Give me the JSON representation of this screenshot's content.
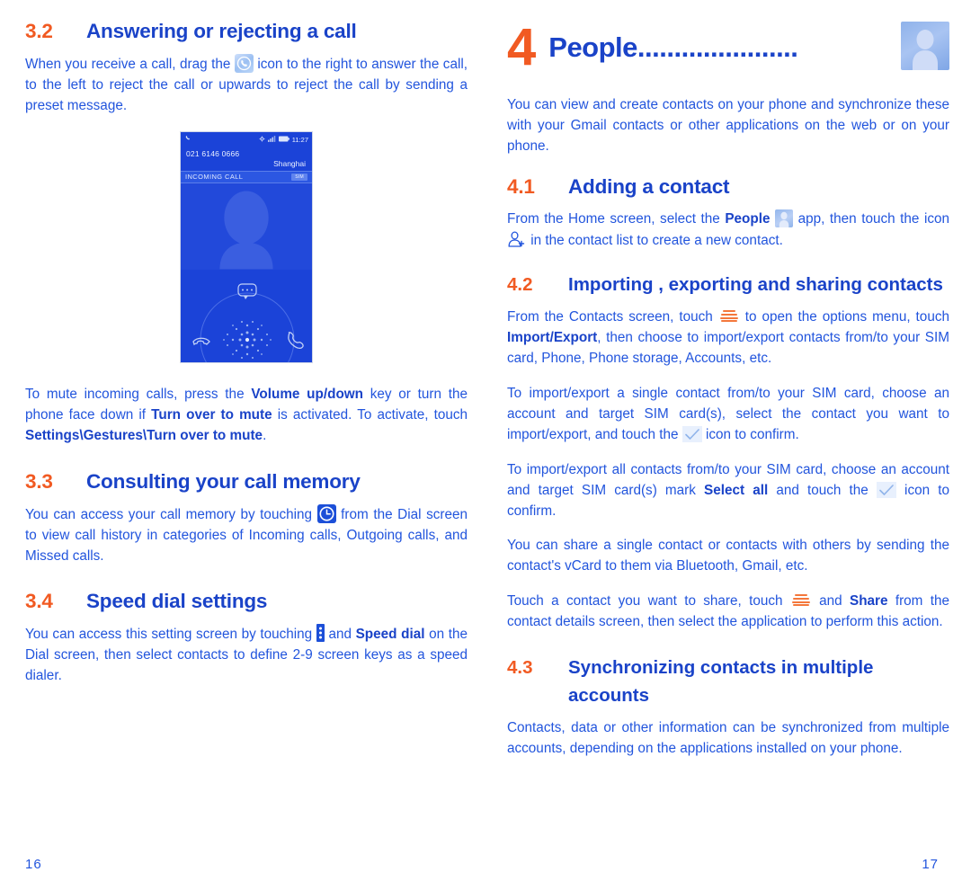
{
  "document": {
    "type": "user-manual-spread",
    "accent_orange": "#f15a22",
    "accent_blue": "#1a43c8",
    "body_blue": "#2255dd"
  },
  "left_page": {
    "page_number": "16",
    "sections": [
      {
        "number": "3.2",
        "title": "Answering or rejecting a call",
        "paragraph_1a": "When you receive a call, drag the ",
        "paragraph_1b": " icon to the right to answer the call, to the left to reject the call or upwards to reject the call by sending a preset message.",
        "paragraph_2a": "To mute incoming calls, press the ",
        "bold_1": "Volume up/down",
        "paragraph_2b": " key or turn the phone face down if ",
        "bold_2": "Turn over to mute",
        "paragraph_2c": " is activated. To activate, touch ",
        "bold_3": "Settings\\Gestures\\Turn over to mute",
        "paragraph_2d": "."
      },
      {
        "number": "3.3",
        "title": "Consulting your call memory",
        "paragraph_1a": "You can access your call memory by touching ",
        "paragraph_1b": " from the Dial screen to view call history in categories of Incoming calls, Outgoing calls, and Missed calls."
      },
      {
        "number": "3.4",
        "title": "Speed dial settings",
        "paragraph_1a": "You can access this setting screen by touching ",
        "paragraph_1b": " and ",
        "bold_1": "Speed dial",
        "paragraph_1c": " on the Dial screen, then select contacts to define 2-9 screen keys as a speed dialer."
      }
    ],
    "phone_mockup": {
      "status_time": "11:27",
      "phone_number": "021 6146 0666",
      "city": "Shanghai",
      "call_state": "INCOMING CALL",
      "sim_badge": "SIM",
      "icons": {
        "status_call": "phone-handset-icon",
        "status_sync": "sync-icon",
        "status_signal": "signal-bars-icon",
        "status_battery": "battery-icon",
        "message": "message-bubble-icon",
        "reject": "hangup-icon",
        "answer": "answer-call-icon"
      }
    }
  },
  "right_page": {
    "page_number": "17",
    "chapter": {
      "number": "4",
      "title": "People",
      "leader": "......................",
      "icon": "people-app-icon"
    },
    "intro": "You can view and create contacts on your phone and synchronize these with your Gmail contacts or other applications on the web or on your phone.",
    "sections": [
      {
        "number": "4.1",
        "title": "Adding a contact",
        "p1a": "From the Home screen, select the ",
        "p1_bold": "People",
        "p1b": " app, then touch the icon ",
        "p1c": " in the contact list to create a new contact."
      },
      {
        "number": "4.2",
        "title": "Importing , exporting and sharing contacts",
        "p1a": "From the Contacts screen, touch ",
        "p1b": " to open the options menu, touch ",
        "p1_bold": "Import/Export",
        "p1c": ", then choose to import/export contacts from/to your SIM card, Phone, Phone storage, Accounts, etc.",
        "p2a": "To import/export a single contact from/to your SIM card, choose an account and target SIM card(s), select the contact you want to import/export, and touch the ",
        "p2b": " icon to confirm.",
        "p3a": "To import/export all contacts from/to your SIM card, choose an account  and target SIM card(s) mark ",
        "p3_bold": "Select all",
        "p3b": " and touch the ",
        "p3c": " icon to confirm.",
        "p4": "You can share a single contact or contacts with others by sending the contact's vCard to them via Bluetooth, Gmail, etc.",
        "p5a": "Touch a contact you want to share, touch ",
        "p5b": " and ",
        "p5_bold": "Share",
        "p5c": " from the contact details screen, then select the application to perform this action."
      },
      {
        "number": "4.3",
        "title": "Synchronizing contacts in multiple accounts",
        "p1": "Contacts, data or other information can be synchronized from multiple accounts, depending on the applications installed on your phone."
      }
    ]
  }
}
